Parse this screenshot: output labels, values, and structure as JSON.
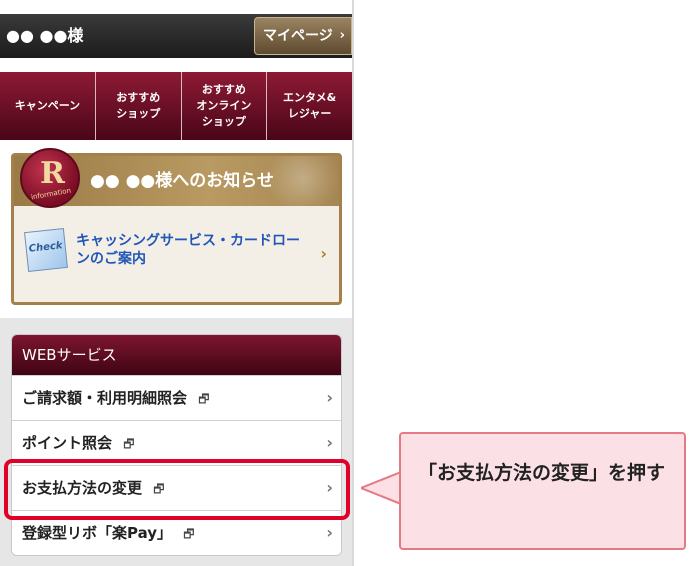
{
  "header": {
    "user_name": "●● ●●様",
    "mypage_label": "マイページ",
    "mypage_arrow": "›"
  },
  "nav": {
    "items": [
      {
        "label": "キャンペーン"
      },
      {
        "label": "おすすめ\nショップ"
      },
      {
        "label": "おすすめ\nオンライン\nショップ"
      },
      {
        "label": "エンタメ&\nレジャー"
      }
    ]
  },
  "info": {
    "seal_glyph": "R",
    "seal_text": "information",
    "title": "●● ●●様へのお知らせ",
    "check_label": "Check",
    "link_text": "キャッシングサービス・カードローンのご案内",
    "chevron": "›"
  },
  "web_services": {
    "title": "WEBサービス",
    "ext_icon": "🗗",
    "chevron": "›",
    "items": [
      {
        "label": "ご請求額・利用明細照会"
      },
      {
        "label": "ポイント照会"
      },
      {
        "label": "お支払方法の変更"
      },
      {
        "label": "登録型リボ「楽Pay」"
      }
    ]
  },
  "callout": {
    "text": "「お支払方法の変更」を押す"
  },
  "colors": {
    "highlight": "#e0002a",
    "callout_bg": "#fbe1e5",
    "nav_bg": "#7a1230",
    "link": "#1f56b8"
  }
}
